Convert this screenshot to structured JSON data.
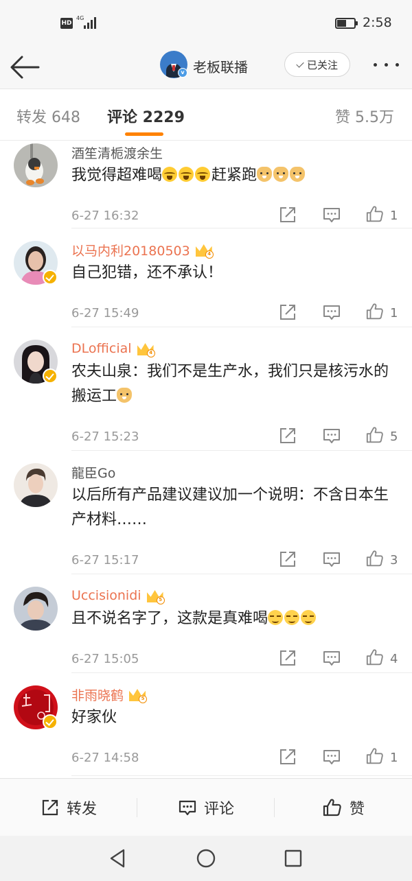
{
  "status_bar": {
    "hd_label": "HD",
    "network_label": "4G",
    "battery_level": 0.55,
    "time": "2:58"
  },
  "header": {
    "title": "老板联播",
    "follow_label": "已关注",
    "verified_color": "#4c9ce6"
  },
  "tabs": [
    {
      "label": "转发 648",
      "active": false
    },
    {
      "label": "评论 2229",
      "active": true
    },
    {
      "label": "赞 5.5万",
      "active": false
    }
  ],
  "accent_color": "#ff8200",
  "comments": [
    {
      "name": "酒笙清栀渡余生",
      "vip": false,
      "verified": false,
      "crown_level": null,
      "text": "我觉得超难喝",
      "emoji_after": [
        "cry-icon",
        "cry-icon",
        "cry-icon"
      ],
      "text2": "赶紧跑",
      "emoji_after2": [
        "doge-icon",
        "doge-icon",
        "doge-icon"
      ],
      "time": "6-27 16:32",
      "likes": "1",
      "avatar_icon": "penguin-keychain-avatar"
    },
    {
      "name": "以马内利20180503",
      "vip": true,
      "verified": true,
      "crown_level": "4",
      "text": "自己犯错，还不承认！",
      "time": "6-27 15:49",
      "likes": "1",
      "avatar_icon": "woman-photo-avatar"
    },
    {
      "name": "DLofficial",
      "vip": true,
      "verified": true,
      "crown_level": "4",
      "text": "农夫山泉：我们不是生产水，我们只是核污水的搬运工",
      "emoji_after": [
        "doge-icon"
      ],
      "time": "6-27 15:23",
      "likes": "5",
      "avatar_icon": "girl-portrait-avatar"
    },
    {
      "name": "龍臣Go",
      "vip": false,
      "verified": false,
      "crown_level": null,
      "text": "以后所有产品建议建议加一个说明：不含日本生产材料……",
      "time": "6-27 15:17",
      "likes": "3",
      "avatar_icon": "man-portrait-avatar"
    },
    {
      "name": "Uccisionidi",
      "vip": true,
      "verified": false,
      "crown_level": "5",
      "text": "且不说名字了，这款是真难喝",
      "emoji_after": [
        "smug-icon",
        "smug-icon",
        "smug-icon"
      ],
      "time": "6-27 15:05",
      "likes": "4",
      "avatar_icon": "boy-portrait-avatar"
    },
    {
      "name": "非雨晓鹤",
      "vip": true,
      "verified": true,
      "crown_level": "5",
      "text": "好家伙",
      "time": "6-27 14:58",
      "likes": "1",
      "avatar_icon": "red-calligraphy-avatar"
    }
  ],
  "bottom_bar": {
    "repost_label": "转发",
    "comment_label": "评论",
    "like_label": "赞"
  },
  "nav": [
    "back-triangle-icon",
    "home-circle-icon",
    "recents-square-icon"
  ]
}
